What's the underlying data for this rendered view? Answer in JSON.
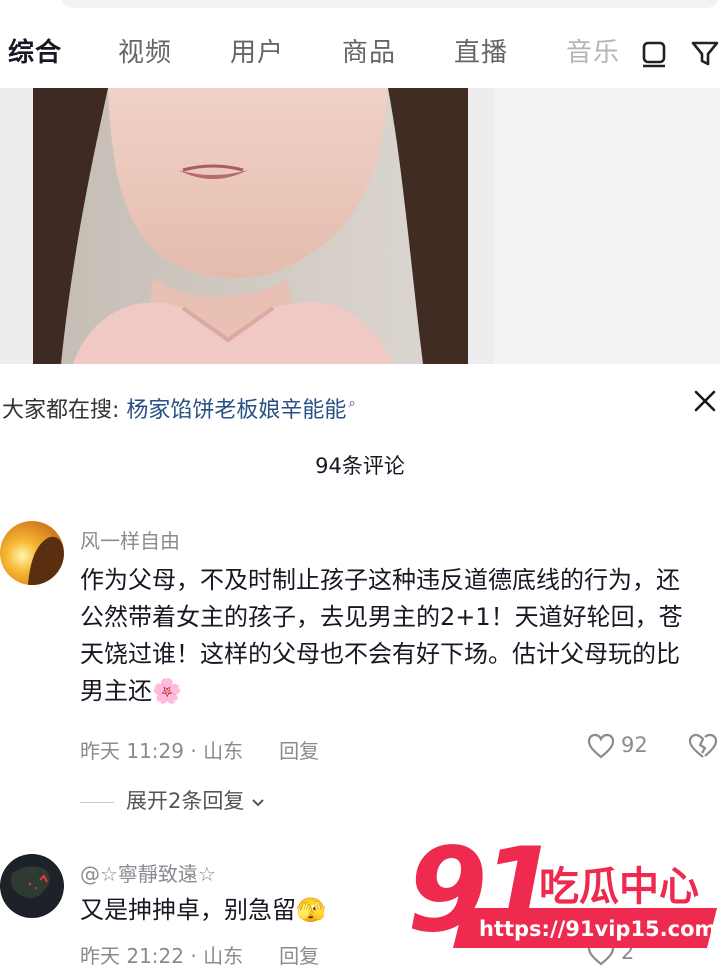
{
  "tabs": [
    {
      "label": "综合"
    },
    {
      "label": "视频"
    },
    {
      "label": "用户"
    },
    {
      "label": "商品"
    },
    {
      "label": "直播"
    },
    {
      "label": "音乐"
    }
  ],
  "trending": {
    "prefix": "大家都在搜:",
    "query": "杨家馅饼老板娘辛能能"
  },
  "comments_count": "94条评论",
  "comments": [
    {
      "username": "风一样自由",
      "text": "作为父母，不及时制止孩子这种违反道德底线的行为，还公然带着女主的孩子，去见男主的2+1！天道好轮回，苍天饶过谁！这样的父母也不会有好下场。估计父母玩的比男主还🌸",
      "time_location": "昨天 11:29 · 山东",
      "reply_label": "回复",
      "likes": "92",
      "expand_replies": "展开2条回复"
    },
    {
      "username": "@☆寧靜致遠☆",
      "text": "又是抻抻卓，别急留🫣",
      "time_location": "昨天 21:22 · 山东",
      "reply_label": "回复",
      "likes": "2"
    }
  ],
  "watermark": {
    "number": "91",
    "title": "吃瓜中心",
    "url": "https://91vip15.com"
  }
}
